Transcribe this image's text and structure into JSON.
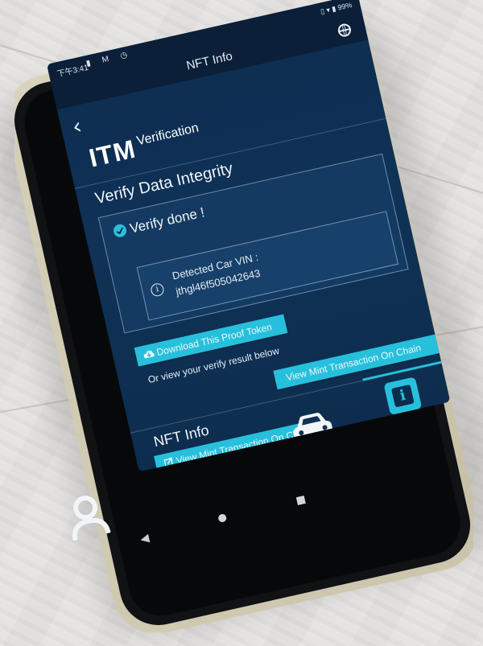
{
  "status_bar": {
    "time": "下午3:41",
    "battery": "99%",
    "left_icons": [
      "notification-icon",
      "gmail-icon",
      "alarm-icon"
    ]
  },
  "header": {
    "title": "NFT Info",
    "back_icon": "chevron-left-icon",
    "language_icon": "globe-icon"
  },
  "brand": {
    "logo": "ITM",
    "subtitle": "Verification"
  },
  "verify": {
    "heading": "Verify Data Integrity",
    "status": "Verify done !",
    "detected_label": "Detected Car VIN :",
    "vin": "jthgl46f505042643"
  },
  "actions": {
    "download_label": "Download This Proof Token",
    "or_text": "Or view your verify result below",
    "mint_label": "View Mint Transaction On Chain"
  },
  "nft_section": {
    "title": "NFT Info",
    "view_label": "View Mint Transaction On Chain"
  },
  "tabs": {
    "items": [
      "person-icon",
      "car-icon",
      "info-icon"
    ],
    "active_index": 2
  },
  "colors": {
    "accent": "#27c0dc",
    "screen_bg": "#0f3256",
    "header_bg": "#0b1f38"
  }
}
